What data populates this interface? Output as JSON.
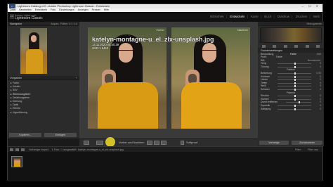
{
  "window": {
    "title": "Lightroom Catalog-v10 - Adobe Photoshop Lightroom Classic - Entwickeln",
    "logo": "Lr",
    "controls": "– ☐ ✕"
  },
  "menubar": [
    "Datei",
    "Bearbeiten",
    "Entwickeln",
    "Foto",
    "Einstellungen",
    "Anzeigen",
    "Fenster",
    "Hilfe"
  ],
  "identity": {
    "subtitle": "Adobe Lightroom",
    "name": "Lightroom Classic",
    "badge": "LrC"
  },
  "modules": {
    "items": [
      "Bibliothek",
      "Entwickeln",
      "Karte",
      "Buch",
      "Diashow",
      "Drucken",
      "Web"
    ],
    "active": "Entwickeln"
  },
  "left_panel": {
    "navigator": {
      "label": "Navigator",
      "zoom": "Anpas. Füllen 1:1 1:4"
    },
    "presets_header": "Vorgaben",
    "presets": [
      "Farbe",
      "Kreativ",
      "S/W",
      "Stereovorgaben",
      "Detailvorgaben",
      "Körnung",
      "Optik",
      "Effekte",
      "Vignettierung"
    ],
    "copy_button": "Kopieren...",
    "paste_button": "Einfügen"
  },
  "photo": {
    "before_label": "Vorher",
    "after_label": "Nachher",
    "filename": "katelyn-montagne-u_el_zIx-unsplash.jpg",
    "date": "14.11.2020 08:40:39",
    "dimensions": "3633 x 5450"
  },
  "center_toolbar": {
    "mode_label": "Vorher und Nachher:",
    "softproof_label": "Softproof"
  },
  "right_panel": {
    "histogram_label": "Histogramm",
    "basic_header": "Grundeinstellungen",
    "treatment_label": "Behandlung:",
    "color_opt": "Farbe",
    "bw_opt": "S/W",
    "profile_label": "Profil:",
    "profile_value": "Farbe",
    "wb_label": "WA:",
    "wb_value": "Benutzerdef.",
    "rows": [
      {
        "label": "Temp",
        "value": "0"
      },
      {
        "label": "Tönung",
        "value": "0"
      },
      {
        "label": "Farbton",
        "value": ""
      },
      {
        "label": "Belichtung",
        "value": "0,00"
      },
      {
        "label": "Kontrast",
        "value": "0"
      },
      {
        "label": "Lichter",
        "value": "0"
      },
      {
        "label": "Tiefen",
        "value": "0"
      },
      {
        "label": "Weiß",
        "value": "0"
      },
      {
        "label": "Schwarz",
        "value": "0"
      },
      {
        "label": "Präsenz",
        "value": ""
      },
      {
        "label": "Struktur",
        "value": "0"
      },
      {
        "label": "Klarheit",
        "value": "0"
      },
      {
        "label": "Dunst entfernen",
        "value": "0"
      },
      {
        "label": "Dynamik",
        "value": "0"
      },
      {
        "label": "Sättigung",
        "value": "0"
      }
    ],
    "previous_button": "Vorherige",
    "reset_button": "Zurücksetzen"
  },
  "filmstrip": {
    "source": "Vorheriger Import",
    "info": "1 Foto / 1 ausgewählt / katelyn-montagne-u_el_zIx-unsplash.jpg",
    "filter_label": "Filter:",
    "filter_value": "Filter aus"
  }
}
